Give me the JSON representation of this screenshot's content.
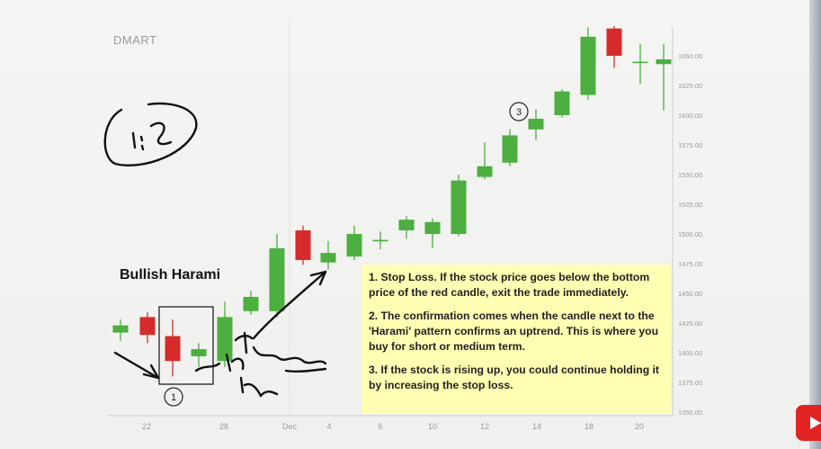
{
  "chart_data": {
    "type": "candlestick",
    "title": "DMART",
    "subtitle": "Bullish Harami",
    "ylim": [
      1350,
      1670
    ],
    "y_ticks": [
      "1650.00",
      "1625.00",
      "1600.00",
      "1575.00",
      "1550.00",
      "1525.00",
      "1500.00",
      "1475.00",
      "1450.00",
      "1425.00",
      "1400.00",
      "1375.00",
      "1350.00"
    ],
    "x_ticks": [
      "22",
      "28",
      "Dec",
      "4",
      "6",
      "10",
      "12",
      "14",
      "18",
      "20"
    ],
    "colors": {
      "up": "#4caf3f",
      "down": "#d62b2b"
    },
    "candles": [
      {
        "open": 1417,
        "close": 1423,
        "high": 1428,
        "low": 1410
      },
      {
        "open": 1430,
        "close": 1415,
        "high": 1434,
        "low": 1408
      },
      {
        "open": 1414,
        "close": 1393,
        "high": 1428,
        "low": 1380
      },
      {
        "open": 1397,
        "close": 1403,
        "high": 1408,
        "low": 1388
      },
      {
        "open": 1393,
        "close": 1430,
        "high": 1443,
        "low": 1388
      },
      {
        "open": 1435,
        "close": 1447,
        "high": 1452,
        "low": 1432
      },
      {
        "open": 1435,
        "close": 1488,
        "high": 1500,
        "low": 1430
      },
      {
        "open": 1503,
        "close": 1478,
        "high": 1507,
        "low": 1474
      },
      {
        "open": 1476,
        "close": 1484,
        "high": 1494,
        "low": 1470
      },
      {
        "open": 1481,
        "close": 1500,
        "high": 1507,
        "low": 1478
      },
      {
        "open": 1495,
        "close": 1495,
        "high": 1502,
        "low": 1487
      },
      {
        "open": 1503,
        "close": 1512,
        "high": 1515,
        "low": 1496
      },
      {
        "open": 1500,
        "close": 1510,
        "high": 1513,
        "low": 1488
      },
      {
        "open": 1500,
        "close": 1545,
        "high": 1550,
        "low": 1498
      },
      {
        "open": 1548,
        "close": 1557,
        "high": 1577,
        "low": 1546
      },
      {
        "open": 1560,
        "close": 1583,
        "high": 1588,
        "low": 1557
      },
      {
        "open": 1588,
        "close": 1597,
        "high": 1605,
        "low": 1579
      },
      {
        "open": 1600,
        "close": 1620,
        "high": 1622,
        "low": 1598
      },
      {
        "open": 1617,
        "close": 1666,
        "high": 1674,
        "low": 1613
      },
      {
        "open": 1673,
        "close": 1650,
        "high": 1675,
        "low": 1640
      },
      {
        "open": 1645,
        "close": 1645,
        "high": 1660,
        "low": 1626
      },
      {
        "open": 1643,
        "close": 1647,
        "high": 1660,
        "low": 1604
      }
    ],
    "annotations": [
      "1",
      "3"
    ]
  },
  "note": {
    "p1": "1. Stop Loss. If the stock price goes below the bottom price of the red candle, exit the trade immediately.",
    "p2": "2. The confirmation comes when the candle next to the 'Harami' pattern confirms an uptrend. This is where you buy for short or medium term.",
    "p3": "3. If the stock is rising up, you could continue holding it by increasing the stop loss."
  },
  "handwriting": {
    "ratio": "1:2"
  }
}
